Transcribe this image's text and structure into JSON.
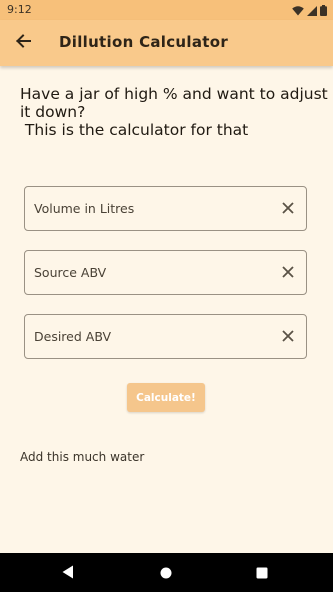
{
  "status_bar": {
    "time": "9:12",
    "icons": [
      "wifi-icon",
      "signal-icon",
      "battery-icon"
    ]
  },
  "app_bar": {
    "title": "Dillution Calculator",
    "back_icon": "arrow-left-icon"
  },
  "intro": {
    "lines": [
      "Have a jar of high % and want to adjust",
      "it down?",
      " This is the calculator for that"
    ]
  },
  "fields": [
    {
      "placeholder": "Volume in Litres",
      "value": ""
    },
    {
      "placeholder": "Source ABV",
      "value": ""
    },
    {
      "placeholder": "Desired ABV",
      "value": ""
    }
  ],
  "calculate_button": {
    "label": "Calculate!"
  },
  "result": {
    "label": "Add this much water"
  },
  "nav_bar": {
    "icons": [
      "back-triangle-icon",
      "home-circle-icon",
      "recents-square-icon"
    ]
  },
  "colors": {
    "background": "#fef6e8",
    "app_bar": "#f9c98b",
    "status_bar": "#f7c07a",
    "button": "#f5c68c",
    "field_border": "#9a9184"
  }
}
